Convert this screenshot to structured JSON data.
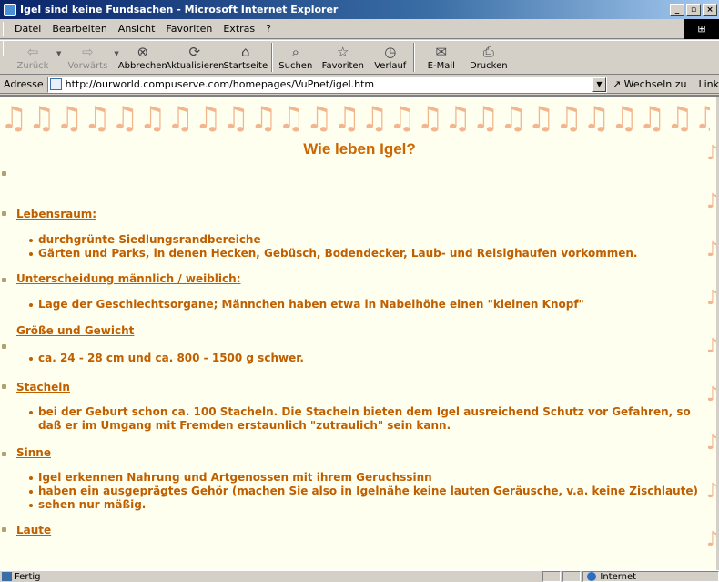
{
  "window": {
    "title": "Igel sind keine Fundsachen - Microsoft Internet Explorer",
    "controls": [
      "_",
      "Ő",
      ""
    ]
  },
  "menu": [
    "Datei",
    "Bearbeiten",
    "Ansicht",
    "Favoriten",
    "Extras",
    "?"
  ],
  "toolbar": {
    "back": "Zurück",
    "forward": "Vorwärts",
    "stop": "Abbrechen",
    "refresh": "Aktualisieren",
    "home": "Startseite",
    "search": "Suchen",
    "favorites": "Favoriten",
    "history": "Verlauf",
    "mail": "E-Mail",
    "print": "Drucken"
  },
  "address": {
    "label": "Adresse",
    "url": "http://ourworld.compuserve.com/homepages/VuPnet/igel.htm",
    "go": "Wechseln zu",
    "links": "Link"
  },
  "page": {
    "title": "Wie leben Igel?",
    "sections": [
      {
        "heading": "Lebensraum:",
        "items": [
          "durchgrünte Siedlungsrandbereiche",
          "Gärten und Parks, in denen Hecken, Gebüsch, Bodendecker, Laub- und Reisighaufen vorkommen."
        ]
      },
      {
        "heading": "Unterscheidung männlich / weiblich:",
        "items": [
          "Lage der Geschlechtsorgane; Männchen haben etwa in Nabelhöhe einen \"kleinen Knopf\""
        ]
      },
      {
        "heading": "Größe und Gewicht",
        "items": [
          "ca. 24 - 28 cm und ca. 800 - 1500 g schwer."
        ]
      },
      {
        "heading": "Stacheln",
        "items": [
          "bei der Geburt schon ca. 100 Stacheln. Die Stacheln bieten dem Igel ausreichend Schutz vor Gefahren, so daß er im Umgang mit Fremden erstaunlich \"zutraulich\" sein kann."
        ]
      },
      {
        "heading": "Sinne",
        "items": [
          "Igel erkennen Nahrung und Artgenossen mit ihrem Geruchssinn",
          "haben ein ausgeprägtes Gehör (machen Sie also in Igelnähe keine lauten Geräusche, v.a. keine Zischlaute)",
          "sehen nur mäßig."
        ]
      },
      {
        "heading": "Laute",
        "items": []
      }
    ]
  },
  "status": {
    "text": "Fertig",
    "zone": "Internet"
  }
}
